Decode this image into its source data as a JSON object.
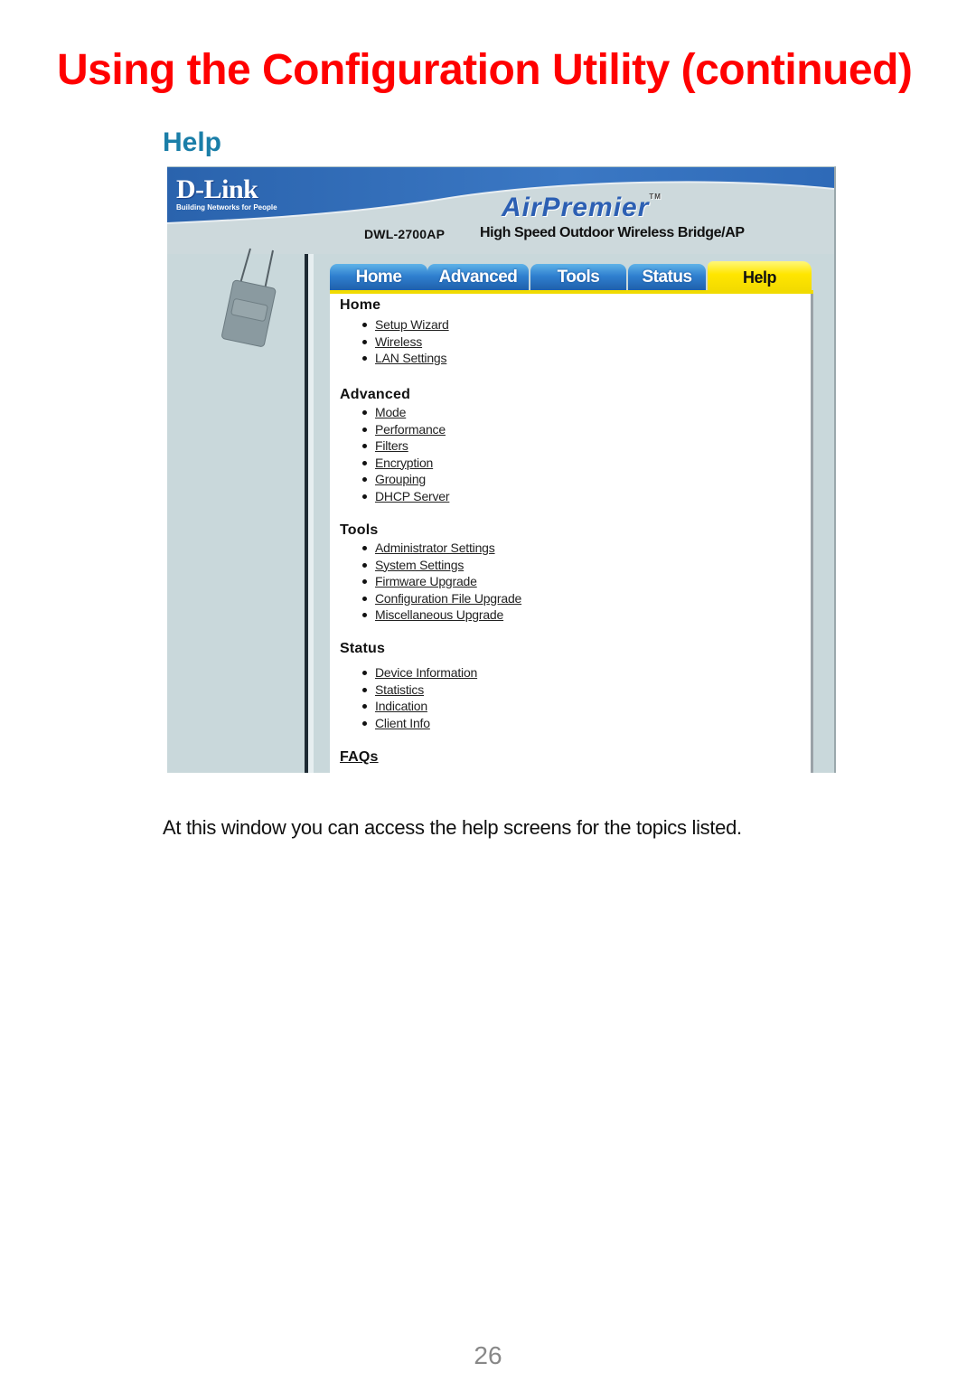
{
  "page": {
    "title": "Using the Configuration Utility (continued)",
    "section_title": "Help",
    "caption": "At this window you can access the help screens for the topics listed.",
    "page_number": "26"
  },
  "screenshot": {
    "brand": {
      "logo_text": "D-Link",
      "tagline": "Building Networks for People",
      "product_line": "AirPremier",
      "trademark": "TM",
      "model": "DWL-2700AP",
      "description": "High Speed Outdoor Wireless Bridge/AP"
    },
    "colors": {
      "tab_blue": "#2f7fcf",
      "tab_active": "#ffe600",
      "title_red": "#ff0000",
      "section_blue": "#1a7ea8"
    },
    "tabs": [
      {
        "label": "Home",
        "active": false
      },
      {
        "label": "Advanced",
        "active": false
      },
      {
        "label": "Tools",
        "active": false
      },
      {
        "label": "Status",
        "active": false
      },
      {
        "label": "Help",
        "active": true
      }
    ],
    "help_groups": [
      {
        "title": "Home",
        "links": [
          "Setup Wizard",
          "Wireless",
          "LAN Settings"
        ]
      },
      {
        "title": "Advanced",
        "links": [
          "Mode",
          "Performance",
          "Filters",
          "Encryption",
          "Grouping",
          "DHCP Server"
        ]
      },
      {
        "title": "Tools",
        "links": [
          "Administrator Settings",
          "System Settings",
          "Firmware Upgrade",
          "Configuration File Upgrade",
          "Miscellaneous Upgrade"
        ]
      },
      {
        "title": "Status",
        "links": [
          "Device Information",
          "Statistics",
          "Indication",
          "Client Info"
        ]
      },
      {
        "title": "FAQs",
        "links": []
      }
    ]
  }
}
